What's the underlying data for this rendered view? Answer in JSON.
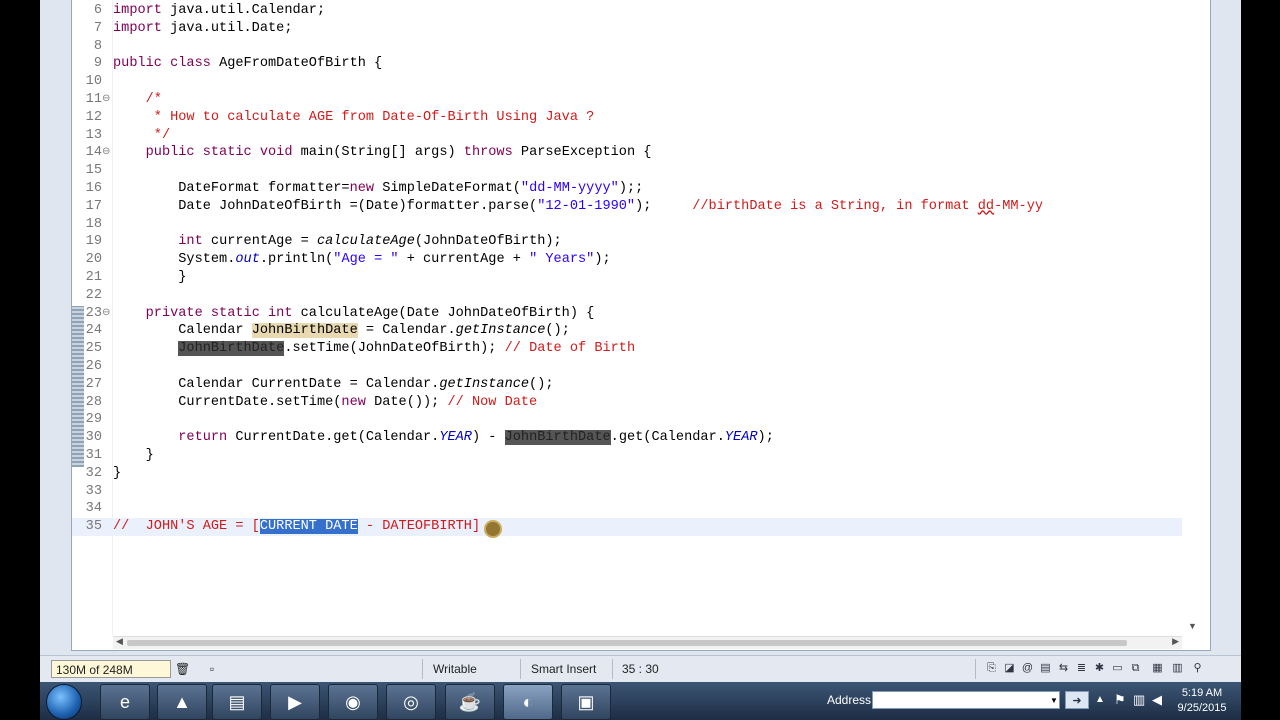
{
  "editor": {
    "lines": [
      {
        "n": "6",
        "fold": "",
        "segs": [
          {
            "t": "import",
            "c": "kw"
          },
          {
            "t": " java.util.Calendar;"
          }
        ]
      },
      {
        "n": "7",
        "fold": "",
        "segs": [
          {
            "t": "import",
            "c": "kw"
          },
          {
            "t": " java.util.Date;"
          }
        ]
      },
      {
        "n": "8",
        "fold": "",
        "segs": []
      },
      {
        "n": "9",
        "fold": "",
        "segs": [
          {
            "t": "public class",
            "c": "kw"
          },
          {
            "t": " AgeFromDateOfBirth {"
          }
        ]
      },
      {
        "n": "10",
        "fold": "",
        "segs": []
      },
      {
        "n": "11",
        "fold": "⊖",
        "segs": [
          {
            "t": "    "
          },
          {
            "t": "/*",
            "c": "cm"
          }
        ]
      },
      {
        "n": "12",
        "fold": "",
        "segs": [
          {
            "t": "     "
          },
          {
            "t": "* How to calculate AGE from Date-Of-Birth Using Java ?",
            "c": "cm"
          }
        ]
      },
      {
        "n": "13",
        "fold": "",
        "segs": [
          {
            "t": "     "
          },
          {
            "t": "*/",
            "c": "cm"
          }
        ]
      },
      {
        "n": "14",
        "fold": "⊖",
        "segs": [
          {
            "t": "    "
          },
          {
            "t": "public static void",
            "c": "kw"
          },
          {
            "t": " main(String[] args) "
          },
          {
            "t": "throws",
            "c": "kw"
          },
          {
            "t": " ParseException {"
          }
        ]
      },
      {
        "n": "15",
        "fold": "",
        "segs": []
      },
      {
        "n": "16",
        "fold": "",
        "segs": [
          {
            "t": "        DateFormat formatter="
          },
          {
            "t": "new",
            "c": "kw"
          },
          {
            "t": " SimpleDateFormat("
          },
          {
            "t": "\"dd-MM-yyyy\"",
            "c": "str"
          },
          {
            "t": ");;"
          }
        ]
      },
      {
        "n": "17",
        "fold": "",
        "segs": [
          {
            "t": "        Date JohnDateOfBirth =(Date)formatter.parse("
          },
          {
            "t": "\"12-01-1990\"",
            "c": "str"
          },
          {
            "t": ");     "
          },
          {
            "t": "//birthDate is a String, in format ",
            "c": "cm"
          },
          {
            "t": "dd",
            "c": "cm under"
          },
          {
            "t": "-MM-yy",
            "c": "cm"
          }
        ]
      },
      {
        "n": "18",
        "fold": "",
        "segs": []
      },
      {
        "n": "19",
        "fold": "",
        "segs": [
          {
            "t": "        "
          },
          {
            "t": "int",
            "c": "kw"
          },
          {
            "t": " currentAge = "
          },
          {
            "t": "calculateAge",
            "c": "it"
          },
          {
            "t": "(JohnDateOfBirth);"
          }
        ]
      },
      {
        "n": "20",
        "fold": "",
        "segs": [
          {
            "t": "        System."
          },
          {
            "t": "out",
            "c": "itb"
          },
          {
            "t": ".println("
          },
          {
            "t": "\"Age = \"",
            "c": "str"
          },
          {
            "t": " + currentAge + "
          },
          {
            "t": "\" Years\"",
            "c": "str"
          },
          {
            "t": ");"
          }
        ]
      },
      {
        "n": "21",
        "fold": "",
        "segs": [
          {
            "t": "        }"
          }
        ]
      },
      {
        "n": "22",
        "fold": "",
        "segs": []
      },
      {
        "n": "23",
        "fold": "⊖",
        "segs": [
          {
            "t": "    "
          },
          {
            "t": "private static int",
            "c": "kw"
          },
          {
            "t": " calculateAge(Date JohnDateOfBirth) {"
          }
        ]
      },
      {
        "n": "24",
        "fold": "",
        "segs": [
          {
            "t": "        Calendar "
          },
          {
            "t": "JohnBirthDate",
            "c": "mk1"
          },
          {
            "t": " = Calendar."
          },
          {
            "t": "getInstance",
            "c": "it"
          },
          {
            "t": "();"
          }
        ]
      },
      {
        "n": "25",
        "fold": "",
        "segs": [
          {
            "t": "        "
          },
          {
            "t": "JohnBirthDate",
            "c": "mk2"
          },
          {
            "t": ".setTime(JohnDateOfBirth); "
          },
          {
            "t": "// Date of Birth",
            "c": "cm"
          }
        ]
      },
      {
        "n": "26",
        "fold": "",
        "segs": []
      },
      {
        "n": "27",
        "fold": "",
        "segs": [
          {
            "t": "        Calendar CurrentDate = Calendar."
          },
          {
            "t": "getInstance",
            "c": "it"
          },
          {
            "t": "();"
          }
        ]
      },
      {
        "n": "28",
        "fold": "",
        "segs": [
          {
            "t": "        CurrentDate.setTime("
          },
          {
            "t": "new",
            "c": "kw"
          },
          {
            "t": " Date()); "
          },
          {
            "t": "// Now Date",
            "c": "cm"
          }
        ]
      },
      {
        "n": "29",
        "fold": "",
        "segs": []
      },
      {
        "n": "30",
        "fold": "",
        "segs": [
          {
            "t": "        "
          },
          {
            "t": "return",
            "c": "kw"
          },
          {
            "t": " CurrentDate.get(Calendar."
          },
          {
            "t": "YEAR",
            "c": "itb"
          },
          {
            "t": ") - "
          },
          {
            "t": "JohnBirthDate",
            "c": "mk2"
          },
          {
            "t": ".get(Calendar."
          },
          {
            "t": "YEAR",
            "c": "itb"
          },
          {
            "t": ");"
          }
        ]
      },
      {
        "n": "31",
        "fold": "",
        "segs": [
          {
            "t": "    }"
          }
        ]
      },
      {
        "n": "32",
        "fold": "",
        "segs": [
          {
            "t": "}"
          }
        ]
      },
      {
        "n": "33",
        "fold": "",
        "segs": []
      },
      {
        "n": "34",
        "fold": "",
        "segs": []
      },
      {
        "n": "35",
        "fold": "",
        "current": true,
        "segs": [
          {
            "t": "//  JOHN'S AGE = [",
            "c": "cm"
          },
          {
            "t": "CURRENT DATE",
            "c": "sel"
          },
          {
            "t": " - DATEOFBIRTH]",
            "c": "cm"
          }
        ]
      }
    ]
  },
  "status": {
    "memory": "130M of 248M",
    "writable": "Writable",
    "insert_mode": "Smart Insert",
    "position": "35 : 30"
  },
  "taskbar": {
    "address_label": "Address",
    "address_value": "",
    "time": "5:19 AM",
    "date": "9/25/2015",
    "apps": [
      {
        "name": "ie-icon",
        "glyph": "e"
      },
      {
        "name": "vlc-icon",
        "glyph": "▲"
      },
      {
        "name": "folder-icon",
        "glyph": "▤"
      },
      {
        "name": "media-player-icon",
        "glyph": "▶"
      },
      {
        "name": "firefox-icon",
        "glyph": "◉"
      },
      {
        "name": "chrome-icon",
        "glyph": "◎"
      },
      {
        "name": "java-app-icon",
        "glyph": "☕"
      },
      {
        "name": "eclipse-icon",
        "glyph": "◐"
      },
      {
        "name": "save-disk-icon",
        "glyph": "▣"
      }
    ]
  },
  "colors": {
    "keyword": "#7f0055",
    "string": "#2a00ff",
    "comment": "#d11b1b",
    "selection": "#3470cc"
  }
}
